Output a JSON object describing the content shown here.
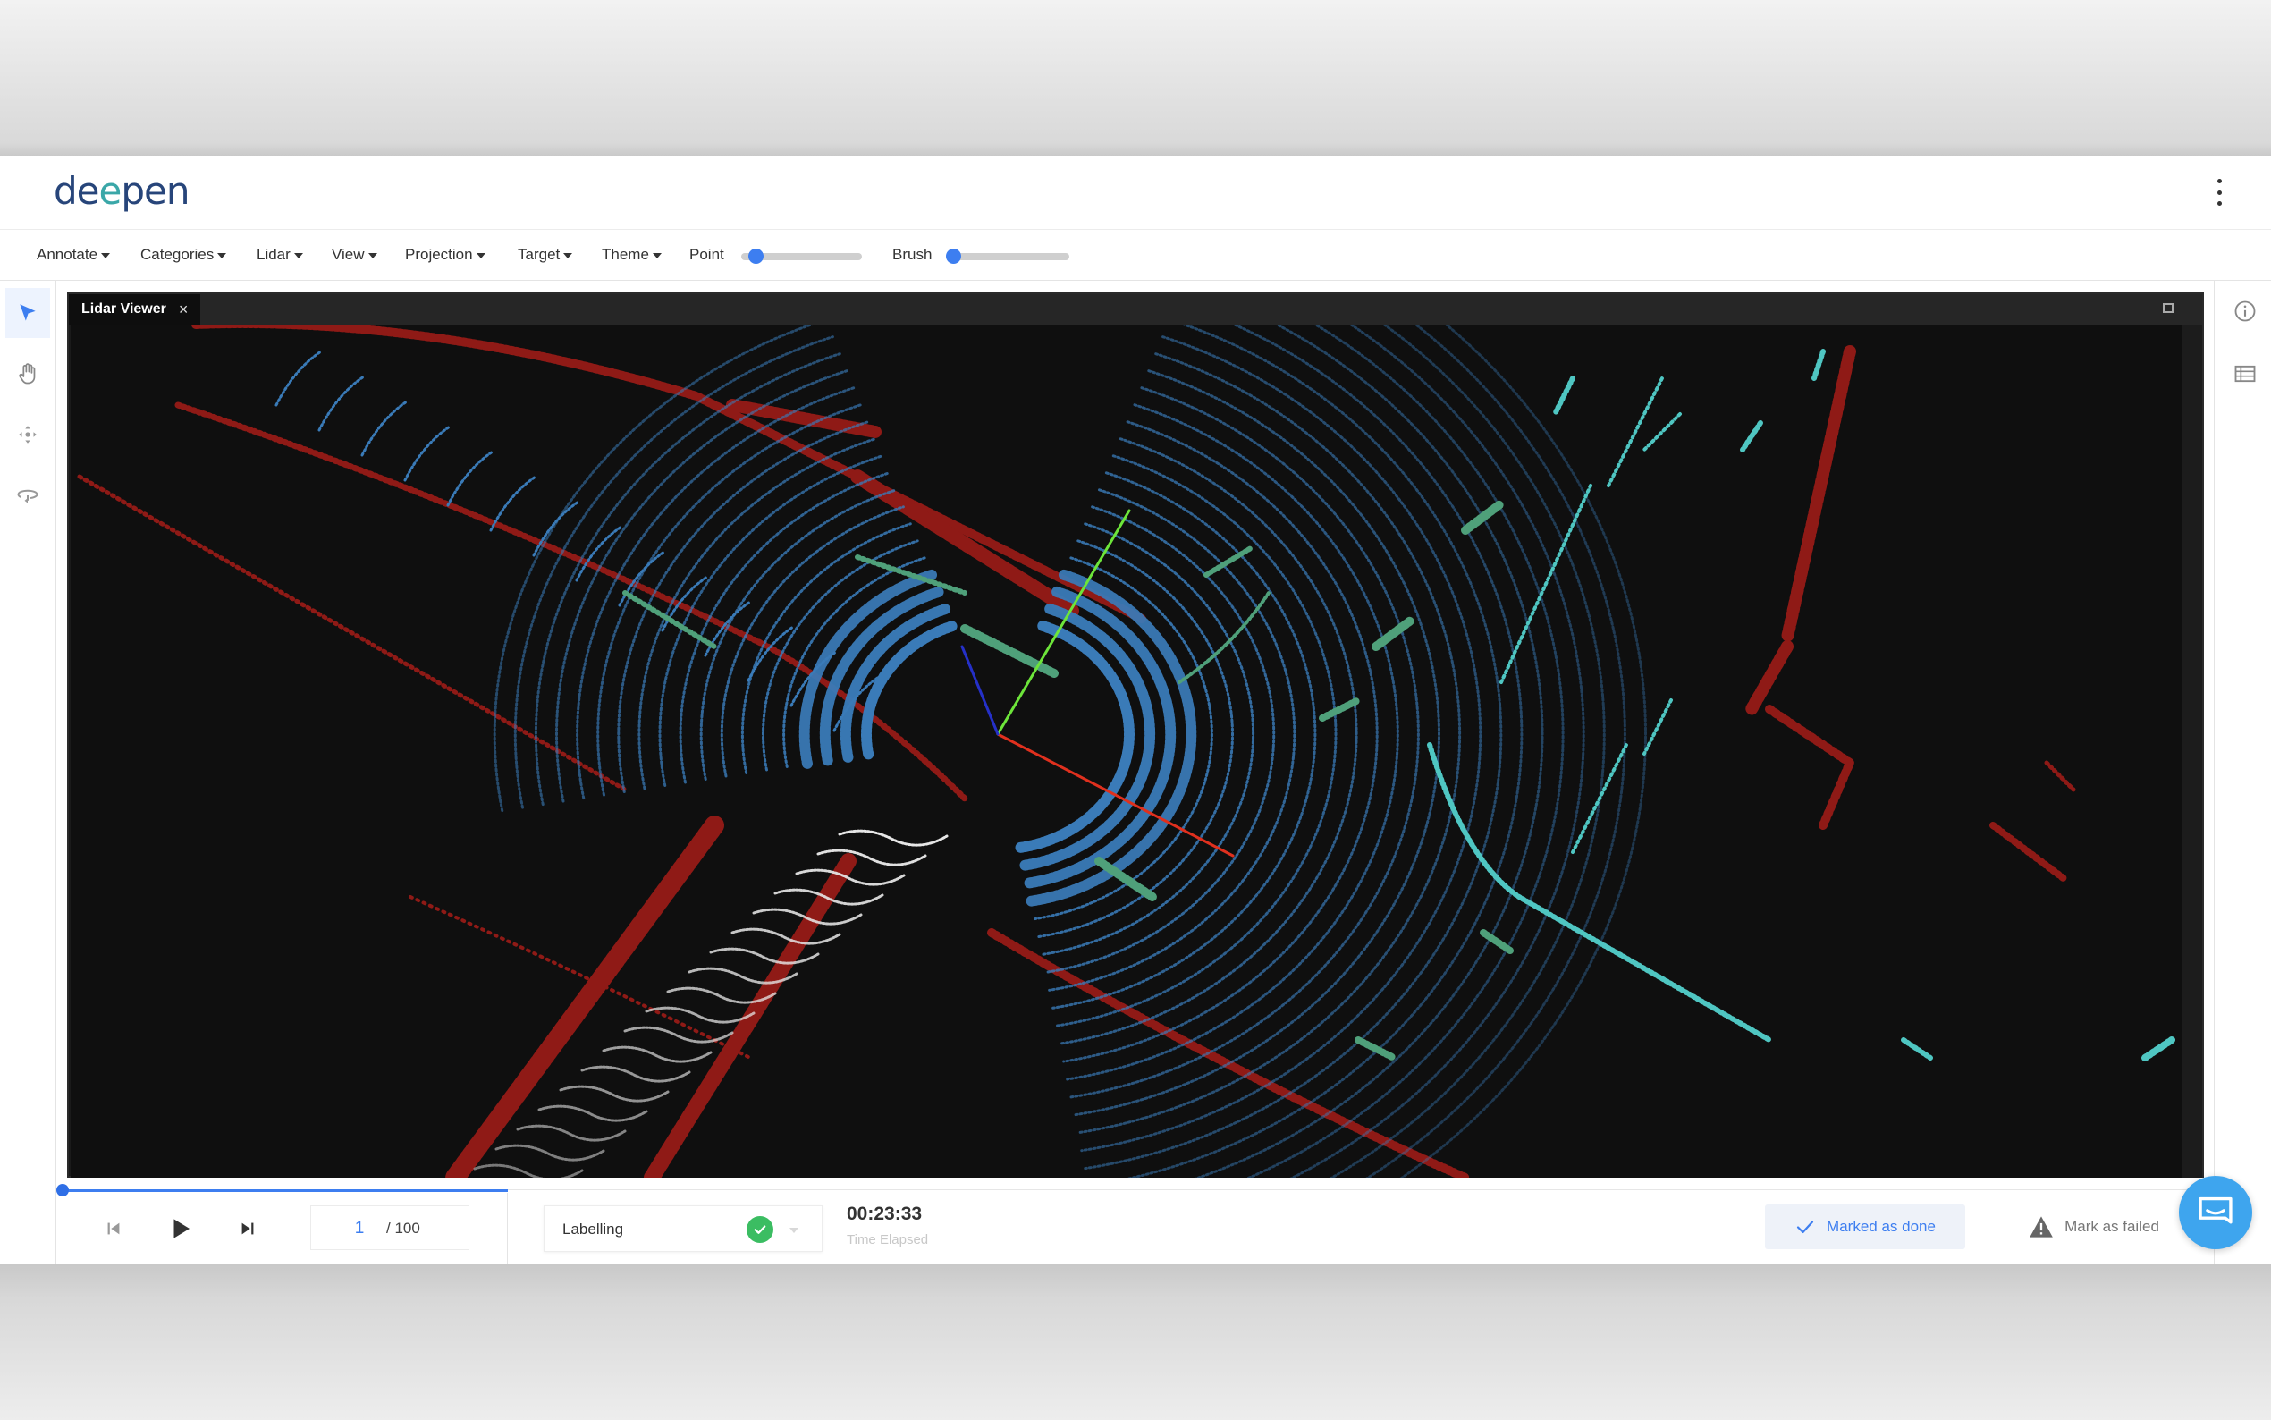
{
  "header": {
    "logo_text_1": "de",
    "logo_text_2": "e",
    "logo_text_3": "pen"
  },
  "menubar": {
    "items": [
      "Annotate",
      "Categories",
      "Lidar",
      "View",
      "Projection",
      "Target",
      "Theme"
    ],
    "point_label": "Point",
    "point_level": 0.07,
    "brush_label": "Brush",
    "brush_level": 0.0
  },
  "left_tools": [
    "select-cursor-icon",
    "hand-pan-icon",
    "move-arrows-icon",
    "orbit-rotate-icon"
  ],
  "right_tools": [
    "info-icon",
    "list-table-icon"
  ],
  "viewer": {
    "tab_title": "Lidar Viewer",
    "close_symbol": "×"
  },
  "playback": {
    "progress_fraction": 0.01,
    "current_frame": "1",
    "total_frames": "/ 100"
  },
  "status": {
    "label": "Labelling",
    "timer": "00:23:33",
    "timer_label": "Time Elapsed"
  },
  "actions": {
    "done_label": "Marked as done",
    "fail_label": "Mark as failed"
  },
  "colors": {
    "accent": "#3d7ef0",
    "logo": "#27457a",
    "logo_accent": "#3aa7a8",
    "success": "#3bbd62",
    "chat": "#3ea5ee",
    "lidar_red": "#8f1a16",
    "lidar_blue": "#3a7bb8",
    "lidar_green": "#4fa07a",
    "lidar_cyan": "#4fc6c2",
    "lidar_white": "#e6e6e6",
    "axis_x": "#e0301e",
    "axis_y": "#6de53a",
    "axis_z": "#2530c8"
  }
}
